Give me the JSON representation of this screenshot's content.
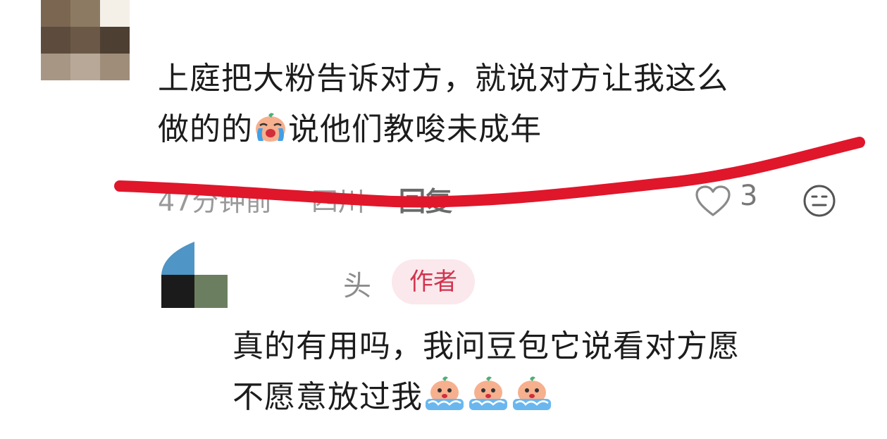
{
  "comment": {
    "text_line1": "上庭把大粉告诉对方，就说对方让我这么",
    "text_line2_before_emoji": "做的的",
    "text_line2_after_emoji": "说他们教唆未成年",
    "emoji": "crying-face-emoji",
    "meta": {
      "time": "47分钟前",
      "location": "四川",
      "reply_label": "回复"
    },
    "like_count": "3"
  },
  "reply": {
    "author_name": "头",
    "author_badge": "作者",
    "text_line1": "真的有用吗，我问豆包它说看对方愿",
    "text_line2": "不愿意放过我",
    "emojis": [
      "crying-face-emoji",
      "crying-face-emoji",
      "crying-face-emoji"
    ]
  },
  "colors": {
    "annotation_red": "#e0162b",
    "badge_bg": "#fbe8ec",
    "badge_text": "#d1344f",
    "meta_gray": "#9a9a9a"
  }
}
